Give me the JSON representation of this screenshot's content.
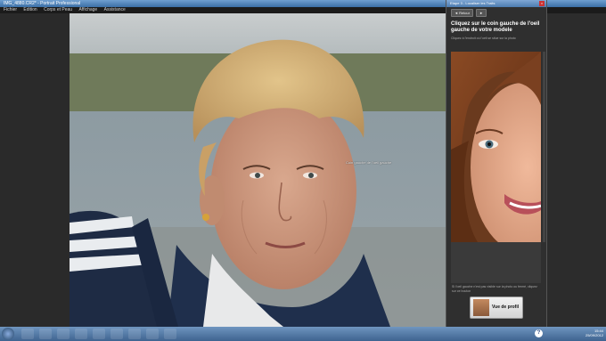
{
  "window": {
    "title": "IMG_4880.CR2* - Portrait Professional"
  },
  "menu": [
    "Fichier",
    "Edition",
    "Corps et Peau",
    "Affichage",
    "Assistance"
  ],
  "canvas": {
    "hint_label": "Coin gauche de l'oeil gauche"
  },
  "panel": {
    "title": "Etape 3 - Localiser les Traits",
    "back_label": "Retour",
    "forward_label": "►",
    "heading": "Cliquez sur le coin gauche de l'oeil gauche de votre modele",
    "description": "Cliquez à l'endroit où l'oeil se situe sur la photo",
    "bottom_text": "Si l'oeil gauche n'est pas visible sur la photo ou fermé, cliquez sur ce bouton",
    "profile_button": "Vue de profil"
  },
  "taskbar": {
    "help_label": "?",
    "time": "15:44",
    "date": "25/09/2012",
    "icons": [
      "windows-start-icon",
      "ie-icon",
      "folder-icon",
      "media-player-icon",
      "firefox-icon",
      "photoshop-icon",
      "app-icon",
      "film-icon",
      "document-icon",
      "portrait-pro-icon"
    ]
  },
  "colors": {
    "titlebar": "#4c7cb0",
    "menubar": "#1b1b1b",
    "panel_bg": "#2f2f2f"
  }
}
